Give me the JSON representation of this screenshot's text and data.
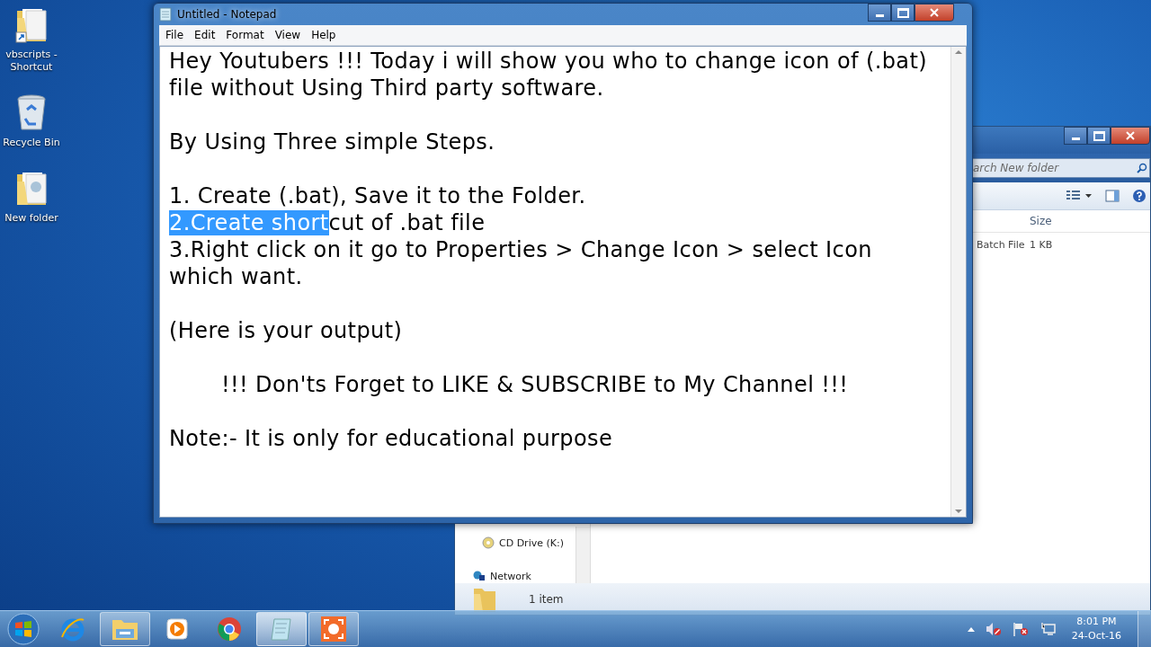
{
  "desktop_icons": [
    {
      "label": "vbscripts - Shortcut",
      "kind": "shortcut"
    },
    {
      "label": "Recycle Bin",
      "kind": "bin"
    },
    {
      "label": "New folder",
      "kind": "folder"
    }
  ],
  "explorer": {
    "search": {
      "placeholder": "arch New folder"
    },
    "columns": [
      "Size"
    ],
    "rows": [
      {
        "type": "Batch File",
        "size": "1 KB"
      }
    ],
    "nav_items": [
      {
        "label": "CD Drive (K:)",
        "kind": "cd"
      },
      {
        "label": "Network",
        "kind": "network"
      }
    ],
    "status": "1 item"
  },
  "notepad": {
    "title": "Untitled - Notepad",
    "menu": [
      "File",
      "Edit",
      "Format",
      "View",
      "Help"
    ],
    "paragraphs": [
      {
        "lines": [
          {
            "text": "Hey Youtubers !!! Today i will show you who to change icon of (.bat)"
          },
          {
            "text": "file without Using Third party software."
          }
        ]
      },
      {
        "lines": [
          {
            "text": "By Using Three simple Steps."
          }
        ]
      },
      {
        "lines": [
          {
            "text": "1. Create (.bat), Save it to the Folder."
          },
          {
            "selected_text": "2.Create short",
            "text": "cut of .bat file"
          },
          {
            "text": "3.Right click on it go to Properties > Change Icon > select Icon"
          },
          {
            "text": "which want."
          }
        ]
      },
      {
        "lines": [
          {
            "text": "(Here is your output)"
          }
        ]
      },
      {
        "lines": [
          {
            "text": "!!! Don'ts Forget to LIKE & SUBSCRIBE to My Channel !!!",
            "indent": true
          }
        ]
      },
      {
        "lines": [
          {
            "text": "Note:- It is only for educational purpose"
          }
        ]
      }
    ]
  },
  "taskbar": {
    "items": [
      {
        "kind": "start",
        "running": false,
        "selected": false
      },
      {
        "kind": "ie",
        "running": false,
        "selected": false
      },
      {
        "kind": "explorer",
        "running": true,
        "selected": false
      },
      {
        "kind": "media",
        "running": false,
        "selected": false
      },
      {
        "kind": "chrome",
        "running": false,
        "selected": false
      },
      {
        "kind": "notepad",
        "running": true,
        "selected": true
      },
      {
        "kind": "recorder",
        "running": true,
        "selected": false
      }
    ],
    "time": "8:01 PM",
    "date": "24-Oct-16"
  }
}
